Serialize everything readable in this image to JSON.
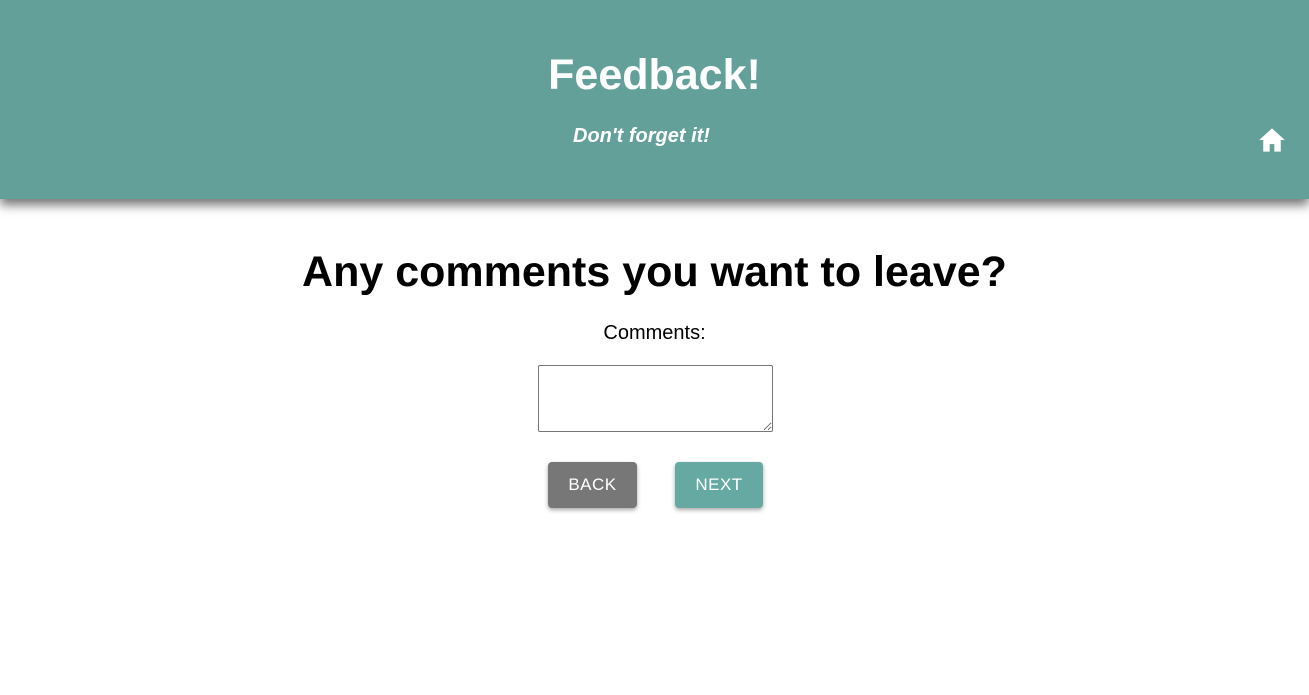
{
  "header": {
    "title": "Feedback!",
    "subtitle": "Don't forget it!",
    "home_icon": "home-icon",
    "background_color": "#64a09a"
  },
  "form": {
    "question": "Any comments you want to leave?",
    "comments_label": "Comments:",
    "comments_value": ""
  },
  "buttons": {
    "back_label": "BACK",
    "next_label": "NEXT",
    "back_color": "#777777",
    "next_color": "#66a9a3"
  }
}
